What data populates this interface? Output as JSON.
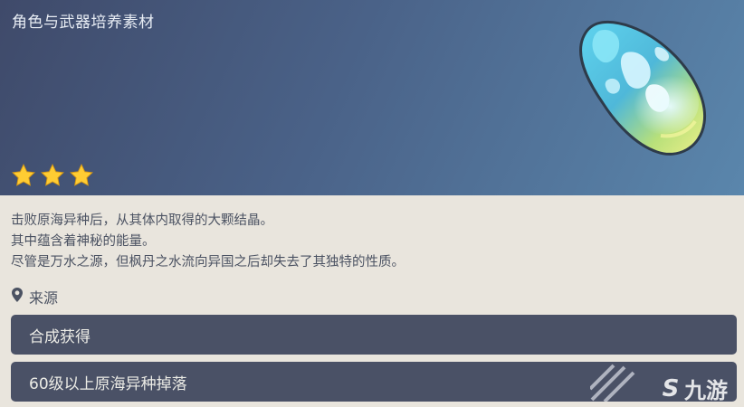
{
  "header": {
    "category": "角色与武器培养素材",
    "rarity_stars": 3,
    "star_color": "#ffcc33"
  },
  "item": {
    "icon": "crystal-icon",
    "description": [
      "击败原海异种后，从其体内取得的大颗结晶。",
      "其中蕴含着神秘的能量。",
      "尽管是万水之源，但枫丹之水流向异国之后却失去了其独特的性质。"
    ]
  },
  "source": {
    "heading": "来源",
    "items": [
      {
        "label": "合成获得"
      },
      {
        "label": "60级以上原海异种掉落"
      }
    ]
  },
  "watermark": {
    "logo": "S",
    "text": "九游"
  }
}
